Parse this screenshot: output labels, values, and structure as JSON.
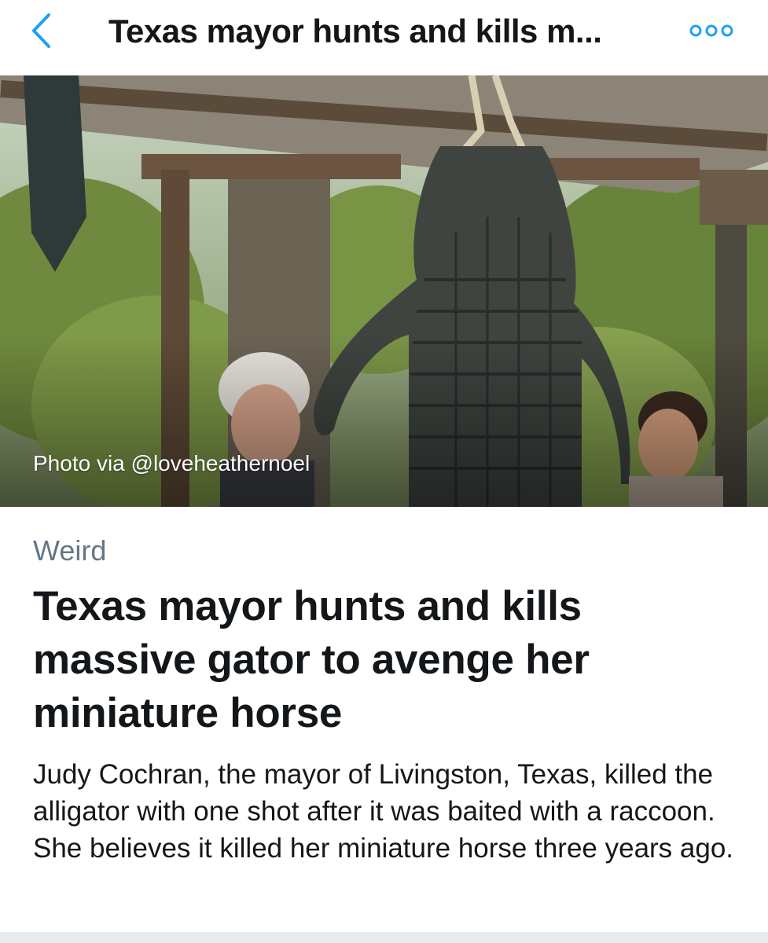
{
  "nav": {
    "title": "Texas mayor hunts and kills m...",
    "back_icon": "chevron-left-icon",
    "more_icon": "more-options-icon",
    "accent_color": "#1da1f2"
  },
  "hero": {
    "photo_credit": "Photo via @loveheathernoel"
  },
  "article": {
    "category": "Weird",
    "headline": "Texas mayor hunts and kills massive gator to avenge her miniature horse",
    "summary": "Judy Cochran, the mayor of Livingston, Texas, killed the alligator with one shot after it was baited with a raccoon. She believes it killed her miniature horse three years ago."
  }
}
